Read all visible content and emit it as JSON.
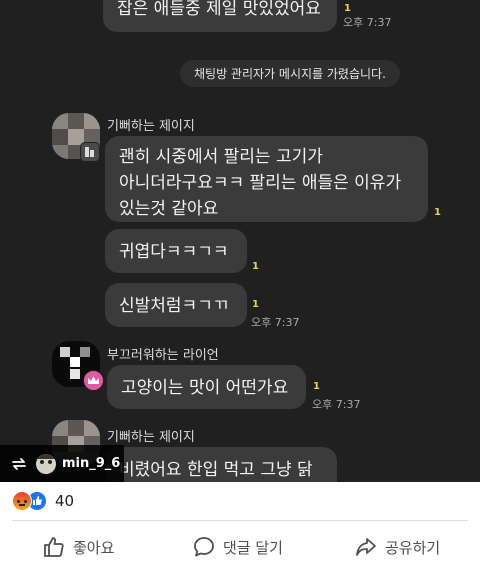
{
  "chat": {
    "messages": [
      {
        "text": "잡은 애들중 제일 맛있었어요",
        "unread": "1",
        "time": "오후 7:37"
      },
      {
        "system": "채팅방 관리자가 메시지를 가렸습니다."
      },
      {
        "sender": "기뻐하는 제이지",
        "text": "괜히 시중에서 팔리는 고기가\n아니더라구요ㅋㅋ 팔리는 애들은 이유가\n있는것 같아요",
        "unread": "1"
      },
      {
        "text": "귀엽다ㅋㅋㄱㅋ",
        "unread": "1"
      },
      {
        "text": "신발처럼ㅋㄱㄲ",
        "unread": "1",
        "time": "오후 7:37"
      },
      {
        "sender": "부끄러워하는 라이언",
        "text": "고양이는 맛이 어떤가요",
        "unread": "1",
        "time": "오후 7:37"
      },
      {
        "sender": "기뻐하는 제이지",
        "text": "비렸어요 한입 먹고 그냥 닭",
        "partial": true
      }
    ],
    "repost": {
      "username": "min_9_6",
      "icon": "repost-icon"
    }
  },
  "footer": {
    "reaction_count": "40",
    "reactions": [
      "angry-reaction-icon",
      "like-reaction-icon"
    ],
    "like_label": "좋아요",
    "comment_label": "댓글 달기",
    "share_label": "공유하기"
  },
  "colors": {
    "chat_bg": "#202020",
    "bubble": "#3b3b3b",
    "unread": "#e8d44d",
    "angry": "#e8643a",
    "like": "#1877f2"
  }
}
